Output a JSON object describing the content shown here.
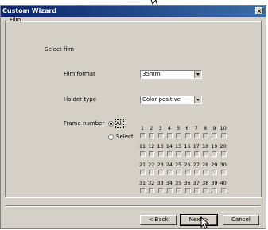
{
  "window": {
    "title": "Custom Wizard",
    "close_label": "×"
  },
  "group": {
    "label": "Film",
    "heading": "Select film"
  },
  "film_format": {
    "label": "Film format",
    "value": "35mm"
  },
  "holder_type": {
    "label": "Holder type",
    "value": "Color positive"
  },
  "frame_number": {
    "label": "Frame number",
    "all_label": "All",
    "select_label": "Select",
    "selected": "All",
    "rows": [
      [
        "1",
        "2",
        "3",
        "4",
        "5",
        "6",
        "7",
        "8",
        "9",
        "10"
      ],
      [
        "11",
        "12",
        "13",
        "14",
        "15",
        "16",
        "17",
        "18",
        "19",
        "20"
      ],
      [
        "21",
        "22",
        "23",
        "24",
        "25",
        "26",
        "27",
        "28",
        "29",
        "30"
      ],
      [
        "31",
        "32",
        "33",
        "34",
        "35",
        "36",
        "37",
        "38",
        "39",
        "40"
      ]
    ],
    "checked": [
      "1"
    ]
  },
  "buttons": {
    "back": "< Back",
    "next": "Next >",
    "cancel": "Cancel"
  }
}
